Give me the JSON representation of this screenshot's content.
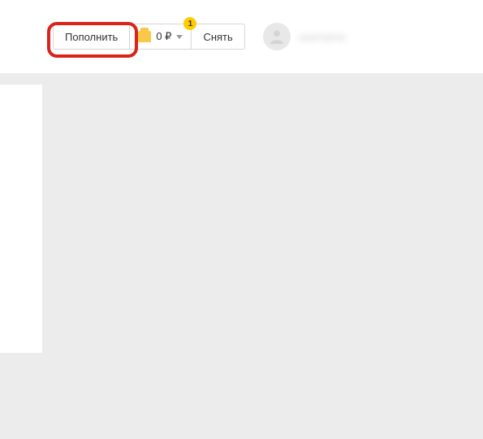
{
  "toolbar": {
    "deposit_label": "Пополнить",
    "balance_amount": "0 ₽",
    "notification_count": "1",
    "withdraw_label": "Снять"
  },
  "user": {
    "name": "username"
  }
}
